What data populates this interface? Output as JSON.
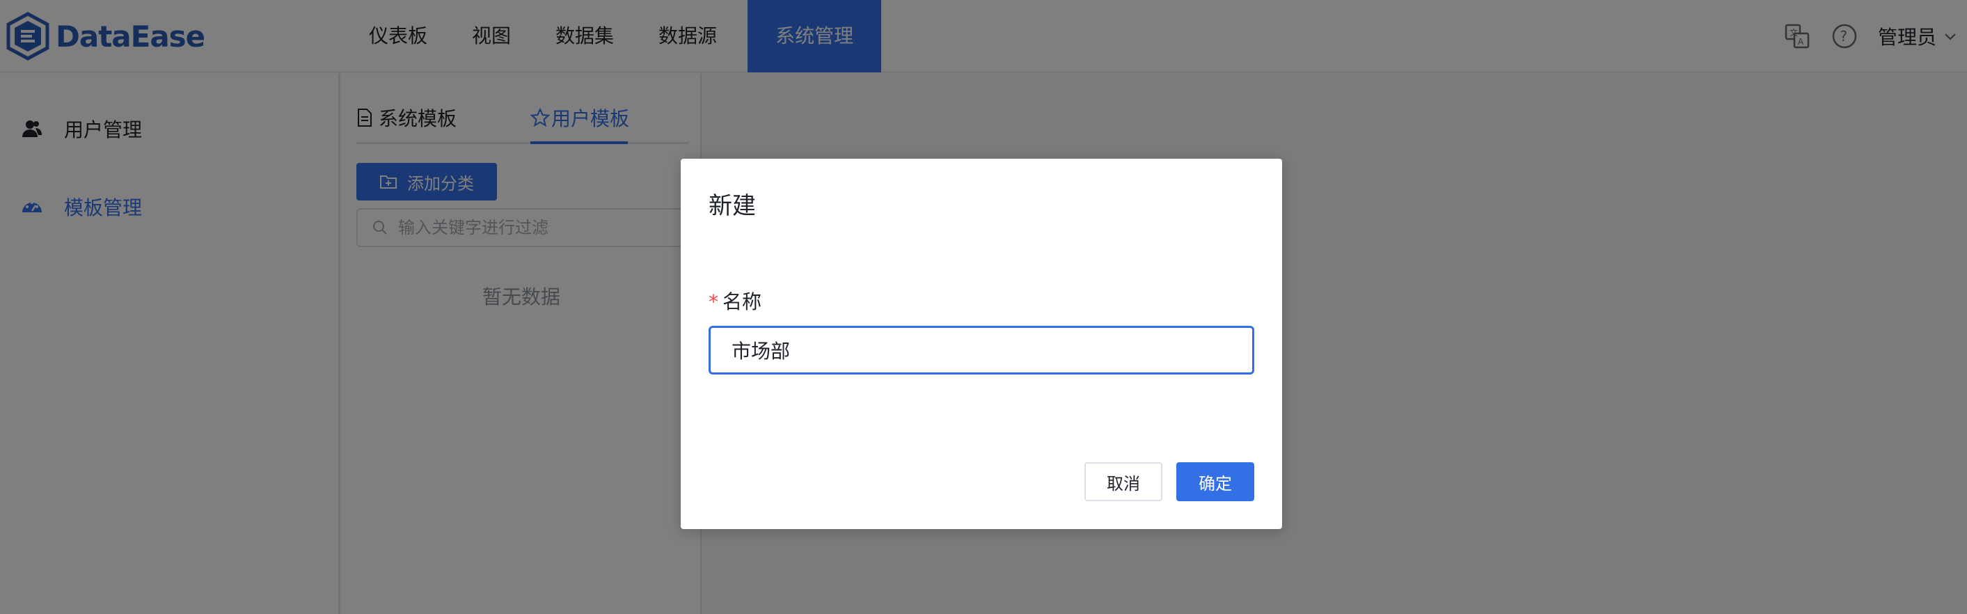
{
  "app": {
    "logo_text": "DataEase"
  },
  "nav": {
    "items": [
      {
        "label": "仪表板"
      },
      {
        "label": "视图"
      },
      {
        "label": "数据集"
      },
      {
        "label": "数据源"
      },
      {
        "label": "系统管理",
        "active": true
      }
    ]
  },
  "header_right": {
    "translate_icon": "translate-icon",
    "help_icon": "help-icon",
    "user_label": "管理员"
  },
  "sidebar": {
    "items": [
      {
        "label": "用户管理",
        "icon": "user-icon"
      },
      {
        "label": "模板管理",
        "icon": "dashboard-icon",
        "active": true
      }
    ]
  },
  "panel": {
    "tabs": [
      {
        "label": "系统模板",
        "icon": "document-icon"
      },
      {
        "label": "用户模板",
        "icon": "star-icon",
        "active": true
      }
    ],
    "add_button": "添加分类",
    "search_placeholder": "输入关键字进行过滤",
    "empty_text": "暂无数据"
  },
  "dialog": {
    "title": "新建",
    "required_mark": "*",
    "name_label": "名称",
    "name_value": "市场部",
    "cancel_label": "取消",
    "confirm_label": "确定"
  },
  "colors": {
    "primary": "#3370e8",
    "brand": "#2c5fb5",
    "required": "#f54a45"
  }
}
